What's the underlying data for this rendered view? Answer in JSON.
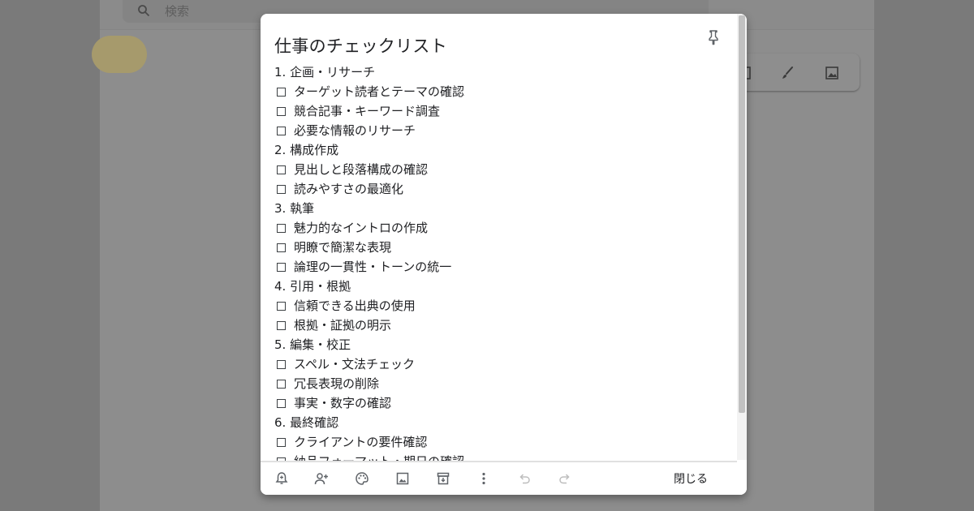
{
  "search": {
    "placeholder": "検索"
  },
  "note": {
    "title": "仕事のチェックリスト",
    "lines": [
      {
        "kind": "heading",
        "text": "1. 企画・リサーチ"
      },
      {
        "kind": "item",
        "text": "ターゲット読者とテーマの確認"
      },
      {
        "kind": "item",
        "text": "競合記事・キーワード調査"
      },
      {
        "kind": "item",
        "text": "必要な情報のリサーチ"
      },
      {
        "kind": "heading",
        "text": "2. 構成作成"
      },
      {
        "kind": "item",
        "text": "見出しと段落構成の確認"
      },
      {
        "kind": "item",
        "text": "読みやすさの最適化"
      },
      {
        "kind": "heading",
        "text": "3. 執筆"
      },
      {
        "kind": "item",
        "text": "魅力的なイントロの作成"
      },
      {
        "kind": "item",
        "text": "明瞭で簡潔な表現"
      },
      {
        "kind": "item",
        "text": "論理の一貫性・トーンの統一"
      },
      {
        "kind": "heading",
        "text": "4. 引用・根拠"
      },
      {
        "kind": "item",
        "text": "信頼できる出典の使用"
      },
      {
        "kind": "item",
        "text": "根拠・証拠の明示"
      },
      {
        "kind": "heading",
        "text": "5. 編集・校正"
      },
      {
        "kind": "item",
        "text": "スペル・文法チェック"
      },
      {
        "kind": "item",
        "text": "冗長表現の削除"
      },
      {
        "kind": "item",
        "text": "事実・数字の確認"
      },
      {
        "kind": "heading",
        "text": "6. 最終確認"
      },
      {
        "kind": "item",
        "text": "クライアントの要件確認"
      },
      {
        "kind": "item",
        "text": "納品フォーマット・期日の確認"
      }
    ]
  },
  "toolbar": {
    "close_label": "閉じる",
    "icons": [
      "reminder-icon",
      "collaborator-icon",
      "palette-icon",
      "image-icon",
      "archive-icon",
      "more-icon",
      "undo-icon",
      "redo-icon"
    ]
  },
  "colors": {
    "overlay": "#7f7f7f",
    "modal": "#ffffff",
    "text": "#202124",
    "chip": "#a69a6c"
  }
}
